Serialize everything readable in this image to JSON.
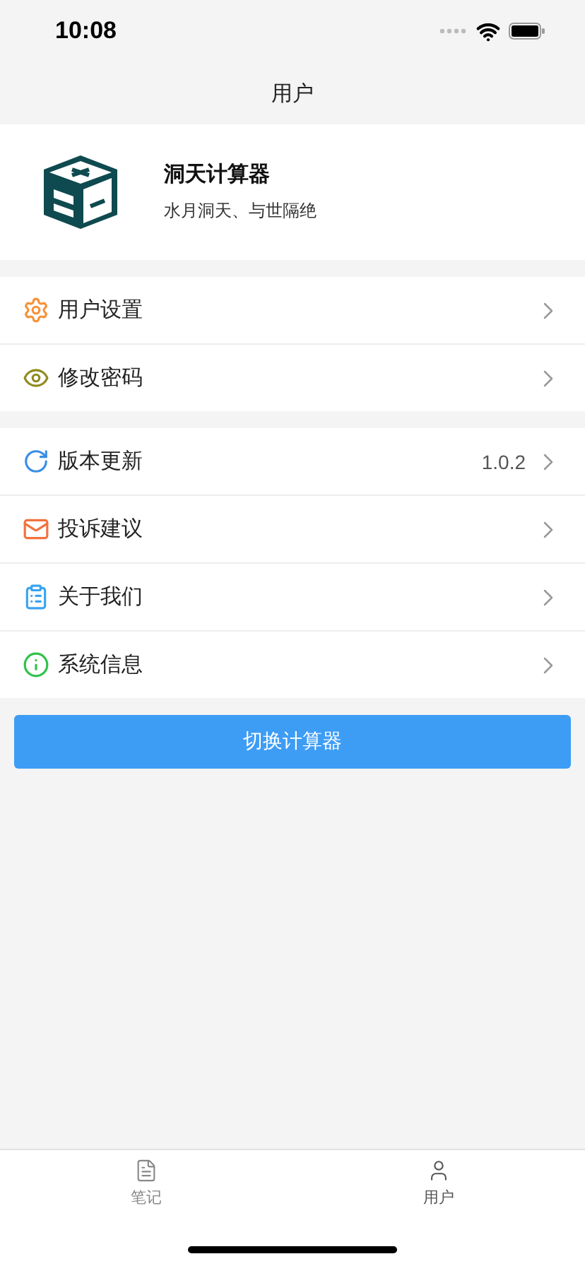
{
  "status_bar": {
    "time": "10:08"
  },
  "nav_bar": {
    "title": "用户"
  },
  "profile": {
    "name": "洞天计算器",
    "motto": "水月洞天、与世隔绝"
  },
  "menu_groups": [
    {
      "items": [
        {
          "kind": "gear",
          "label": "用户设置",
          "color": "#f7923a"
        },
        {
          "kind": "eye",
          "label": "修改密码",
          "color": "#8f8a1e"
        }
      ]
    },
    {
      "items": [
        {
          "kind": "refresh",
          "label": "版本更新",
          "value": "1.0.2",
          "color": "#3a8ee6"
        },
        {
          "kind": "mail",
          "label": "投诉建议",
          "color": "#f2723f"
        },
        {
          "kind": "clipboard",
          "label": "关于我们",
          "color": "#3aa4f0"
        },
        {
          "kind": "info",
          "label": "系统信息",
          "color": "#2fc24a"
        }
      ]
    }
  ],
  "switch_button": {
    "label": "切换计算器"
  },
  "tab_bar": [
    {
      "kind": "notes",
      "label": "笔记",
      "selected": false
    },
    {
      "kind": "user",
      "label": "用户",
      "selected": true
    }
  ]
}
